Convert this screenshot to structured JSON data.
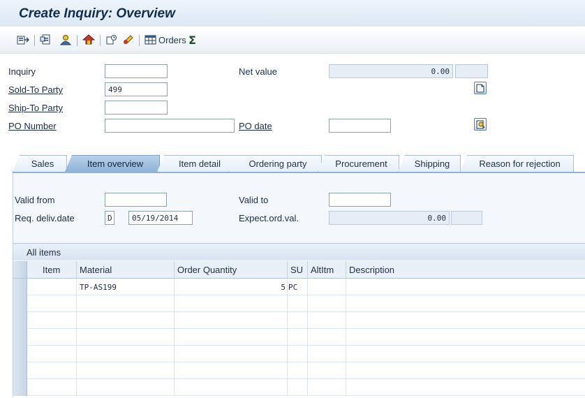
{
  "window": {
    "title": "Create Inquiry: Overview"
  },
  "toolbar": {
    "orders_label": "Orders"
  },
  "header": {
    "inquiry_label": "Inquiry",
    "inquiry_value": "",
    "net_value_label": "Net value",
    "net_value": "0.00",
    "net_value_currency": "",
    "sold_to_label": "Sold-To Party",
    "sold_to_value": "499",
    "ship_to_label": "Ship-To Party",
    "ship_to_value": "",
    "po_number_label": "PO Number",
    "po_number_value": "",
    "po_date_label": "PO date",
    "po_date_value": ""
  },
  "tabs": [
    {
      "label": "Sales"
    },
    {
      "label": "Item overview"
    },
    {
      "label": "Item detail"
    },
    {
      "label": "Ordering party"
    },
    {
      "label": "Procurement"
    },
    {
      "label": "Shipping"
    },
    {
      "label": "Reason for rejection"
    }
  ],
  "active_tab": "Item overview",
  "item_overview": {
    "valid_from_label": "Valid from",
    "valid_from_value": "",
    "valid_to_label": "Valid to",
    "valid_to_value": "",
    "req_deliv_label": "Req. deliv.date",
    "req_deliv_type": "D",
    "req_deliv_value": "05/19/2014",
    "expect_label": "Expect.ord.val.",
    "expect_value": "0.00",
    "expect_currency": ""
  },
  "items_table": {
    "title": "All items",
    "columns": [
      "Item",
      "Material",
      "Order Quantity",
      "SU",
      "AltItm",
      "Description"
    ],
    "rows": [
      {
        "item": "",
        "material": "TP-AS199",
        "quantity": "5",
        "su": "PC",
        "altitm": "",
        "description": ""
      }
    ]
  },
  "colors": {
    "title": "#0f2d52",
    "active_tab": "#8fb3d8",
    "readonly_field": "#e6edf5"
  },
  "icons": [
    "save-icon",
    "back-icon",
    "header-icon",
    "business-partner-icon",
    "display-doc-flow-icon",
    "status-overview-icon",
    "change-icon",
    "orders-table-icon",
    "sum-icon",
    "new-document-icon",
    "display-icon"
  ]
}
